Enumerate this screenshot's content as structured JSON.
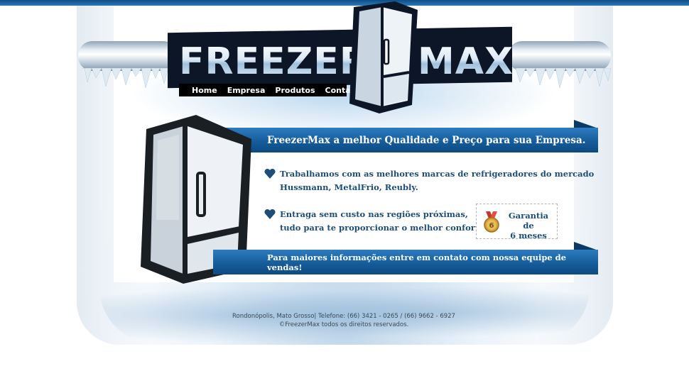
{
  "brand": {
    "left": "FREEZER",
    "right": "MAX"
  },
  "nav": {
    "items": [
      "Home",
      "Empresa",
      "Produtos",
      "Contato"
    ]
  },
  "banner": {
    "headline": "FreezerMax a melhor Qualidade e Preço para sua Empresa."
  },
  "features": [
    {
      "line1": "Trabalhamos com as melhores marcas de refrigeradores do mercado",
      "line2": "Hussmann, MetalFrio, Reubly."
    },
    {
      "line1": "Entraga sem custo nas regiões próximas,",
      "line2": "tudo para te proporcionar o melhor conforto."
    }
  ],
  "warranty": {
    "medal_number": "6",
    "line1": "Garantia de",
    "line2": "6 meses"
  },
  "cta": {
    "text": "Para maiores informações entre em contato com nossa equipe de vendas!"
  },
  "footer": {
    "line1": "Rondonópolis, Mato Grosso| Telefone: (66) 3421 - 0265 / (66) 9662 - 6927",
    "line2": "©FreezerMax todos os direitos reservados."
  },
  "colors": {
    "accent_blue": "#155a98",
    "text_blue": "#1d4e7a",
    "top_strip": "#0f4d86"
  }
}
